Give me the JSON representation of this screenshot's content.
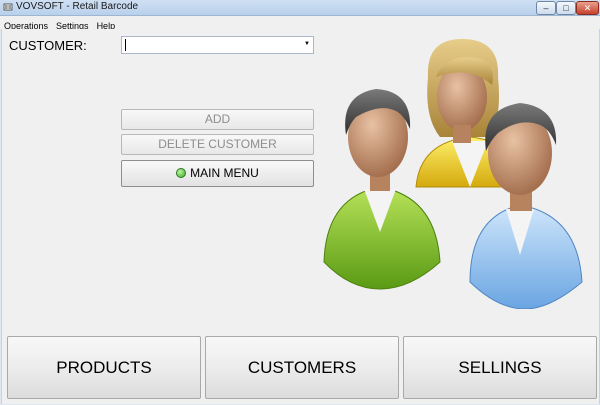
{
  "window": {
    "title": "VOVSOFT - Retail Barcode",
    "min_glyph": "–",
    "max_glyph": "□",
    "close_glyph": "✕"
  },
  "menu": {
    "items": [
      "Operations",
      "Settings",
      "Help"
    ]
  },
  "form": {
    "customer_label": "CUSTOMER:",
    "customer_value": "",
    "combo_arrow": "▼"
  },
  "buttons": {
    "add": "ADD",
    "delete_customer": "DELETE CUSTOMER",
    "main_menu": "MAIN MENU"
  },
  "nav": {
    "products": "PRODUCTS",
    "customers": "CUSTOMERS",
    "sellings": "SELLINGS"
  },
  "icons": {
    "people": "customers-group-icon",
    "main_menu_bullet": "green-dot-icon"
  },
  "colors": {
    "person_green": "#7cc22a",
    "person_yellow": "#f2d21e",
    "person_blue": "#8fc0ef",
    "hair_dark": "#4a4a4a",
    "hair_blonde": "#c9a75a",
    "skin": "#c89a7a"
  }
}
